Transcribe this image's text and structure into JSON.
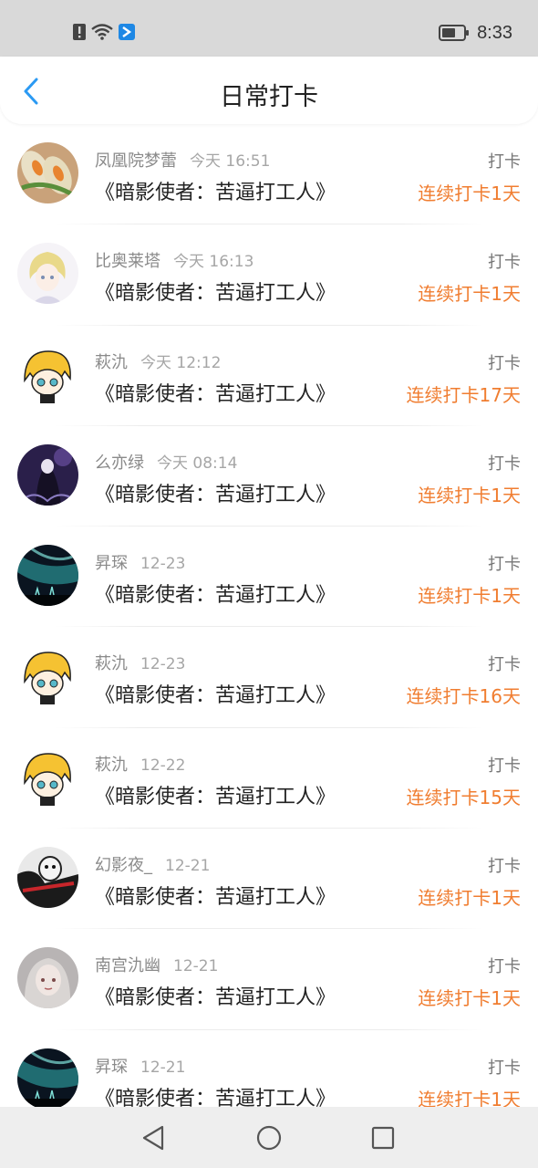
{
  "status_bar": {
    "time": "8:33",
    "icons": [
      "alert-icon",
      "wifi-icon",
      "app-notification-icon",
      "battery-icon"
    ]
  },
  "header": {
    "title": "日常打卡",
    "back_icon": "back-arrow-icon"
  },
  "colors": {
    "accent": "#2b9af3",
    "streak": "#f07d30",
    "status_bar_bg": "#d9d9d9",
    "nav_bar_bg": "#eeeeee"
  },
  "checkins": [
    {
      "name": "凤凰院梦蕾",
      "time": "今天 16:51",
      "book": "《暗影使者：苦逼打工人》",
      "action": "打卡",
      "streak": "连续打卡1天"
    },
    {
      "name": "比奥莱塔",
      "time": "今天 16:13",
      "book": "《暗影使者：苦逼打工人》",
      "action": "打卡",
      "streak": "连续打卡1天"
    },
    {
      "name": "萩氿",
      "time": "今天 12:12",
      "book": "《暗影使者：苦逼打工人》",
      "action": "打卡",
      "streak": "连续打卡17天"
    },
    {
      "name": "么亦绿",
      "time": "今天 08:14",
      "book": "《暗影使者：苦逼打工人》",
      "action": "打卡",
      "streak": "连续打卡1天"
    },
    {
      "name": "昇琛",
      "time": "12-23",
      "book": "《暗影使者：苦逼打工人》",
      "action": "打卡",
      "streak": "连续打卡1天"
    },
    {
      "name": "萩氿",
      "time": "12-23",
      "book": "《暗影使者：苦逼打工人》",
      "action": "打卡",
      "streak": "连续打卡16天"
    },
    {
      "name": "萩氿",
      "time": "12-22",
      "book": "《暗影使者：苦逼打工人》",
      "action": "打卡",
      "streak": "连续打卡15天"
    },
    {
      "name": "幻影夜_",
      "time": "12-21",
      "book": "《暗影使者：苦逼打工人》",
      "action": "打卡",
      "streak": "连续打卡1天"
    },
    {
      "name": "南宫氿幽",
      "time": "12-21",
      "book": "《暗影使者：苦逼打工人》",
      "action": "打卡",
      "streak": "连续打卡1天"
    },
    {
      "name": "昇琛",
      "time": "12-21",
      "book": "《暗影使者：苦逼打工人》",
      "action": "打卡",
      "streak": "连续打卡1天"
    }
  ],
  "nav_bar": {
    "icons": [
      "back-triangle-icon",
      "home-circle-icon",
      "recents-square-icon"
    ]
  }
}
